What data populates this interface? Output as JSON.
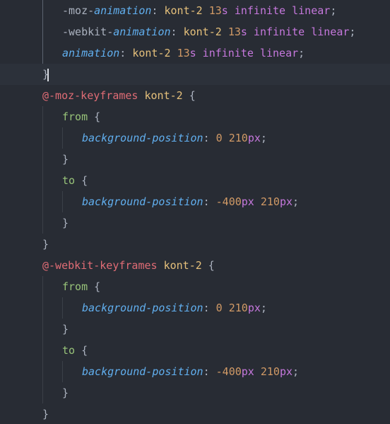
{
  "editor": {
    "theme_colors": {
      "background": "#282c34",
      "property": "#61afef",
      "name": "#e5c07b",
      "number": "#d19a66",
      "unit_keyword": "#c678dd",
      "atrule": "#e06c75",
      "selector": "#98c379",
      "punctuation": "#abb2bf"
    },
    "lines": [
      {
        "tokens": [
          {
            "text": "-moz-",
            "type": "prefix"
          },
          {
            "text": "animation",
            "type": "prop"
          },
          {
            "text": ": ",
            "type": "punct"
          },
          {
            "text": "kont-2",
            "type": "value"
          },
          {
            "text": " ",
            "type": "punct"
          },
          {
            "text": "13",
            "type": "number"
          },
          {
            "text": "s",
            "type": "unit"
          },
          {
            "text": " infinite linear",
            "type": "keyword"
          },
          {
            "text": ";",
            "type": "punct"
          }
        ]
      },
      {
        "tokens": [
          {
            "text": "-webkit-",
            "type": "prefix"
          },
          {
            "text": "animation",
            "type": "prop"
          },
          {
            "text": ": ",
            "type": "punct"
          },
          {
            "text": "kont-2",
            "type": "value"
          },
          {
            "text": " ",
            "type": "punct"
          },
          {
            "text": "13",
            "type": "number"
          },
          {
            "text": "s",
            "type": "unit"
          },
          {
            "text": " infinite linear",
            "type": "keyword"
          },
          {
            "text": ";",
            "type": "punct"
          }
        ]
      },
      {
        "tokens": [
          {
            "text": "animation",
            "type": "prop"
          },
          {
            "text": ": ",
            "type": "punct"
          },
          {
            "text": "kont-2",
            "type": "value"
          },
          {
            "text": " ",
            "type": "punct"
          },
          {
            "text": "13",
            "type": "number"
          },
          {
            "text": "s",
            "type": "unit"
          },
          {
            "text": " infinite linear",
            "type": "keyword"
          },
          {
            "text": ";",
            "type": "punct"
          }
        ]
      },
      {
        "tokens": [
          {
            "text": "}",
            "type": "punct"
          }
        ]
      },
      {
        "tokens": [
          {
            "text": "@-moz-keyframes",
            "type": "atrule"
          },
          {
            "text": " ",
            "type": "punct"
          },
          {
            "text": "kont-2",
            "type": "name"
          },
          {
            "text": " {",
            "type": "punct"
          }
        ]
      },
      {
        "tokens": [
          {
            "text": "from",
            "type": "selector"
          },
          {
            "text": " {",
            "type": "punct"
          }
        ]
      },
      {
        "tokens": [
          {
            "text": "background-position",
            "type": "prop"
          },
          {
            "text": ": ",
            "type": "punct"
          },
          {
            "text": "0",
            "type": "number"
          },
          {
            "text": " ",
            "type": "punct"
          },
          {
            "text": "210",
            "type": "number"
          },
          {
            "text": "px",
            "type": "unit"
          },
          {
            "text": ";",
            "type": "punct"
          }
        ]
      },
      {
        "tokens": [
          {
            "text": "}",
            "type": "punct"
          }
        ]
      },
      {
        "tokens": [
          {
            "text": "to",
            "type": "selector"
          },
          {
            "text": " {",
            "type": "punct"
          }
        ]
      },
      {
        "tokens": [
          {
            "text": "background-position",
            "type": "prop"
          },
          {
            "text": ": ",
            "type": "punct"
          },
          {
            "text": "-400",
            "type": "number"
          },
          {
            "text": "px",
            "type": "unit"
          },
          {
            "text": " ",
            "type": "punct"
          },
          {
            "text": "210",
            "type": "number"
          },
          {
            "text": "px",
            "type": "unit"
          },
          {
            "text": ";",
            "type": "punct"
          }
        ]
      },
      {
        "tokens": [
          {
            "text": "}",
            "type": "punct"
          }
        ]
      },
      {
        "tokens": [
          {
            "text": "}",
            "type": "punct"
          }
        ]
      },
      {
        "tokens": [
          {
            "text": "@-webkit-keyframes",
            "type": "atrule"
          },
          {
            "text": " ",
            "type": "punct"
          },
          {
            "text": "kont-2",
            "type": "name"
          },
          {
            "text": " {",
            "type": "punct"
          }
        ]
      },
      {
        "tokens": [
          {
            "text": "from",
            "type": "selector"
          },
          {
            "text": " {",
            "type": "punct"
          }
        ]
      },
      {
        "tokens": [
          {
            "text": "background-position",
            "type": "prop"
          },
          {
            "text": ": ",
            "type": "punct"
          },
          {
            "text": "0",
            "type": "number"
          },
          {
            "text": " ",
            "type": "punct"
          },
          {
            "text": "210",
            "type": "number"
          },
          {
            "text": "px",
            "type": "unit"
          },
          {
            "text": ";",
            "type": "punct"
          }
        ]
      },
      {
        "tokens": [
          {
            "text": "}",
            "type": "punct"
          }
        ]
      },
      {
        "tokens": [
          {
            "text": "to",
            "type": "selector"
          },
          {
            "text": " {",
            "type": "punct"
          }
        ]
      },
      {
        "tokens": [
          {
            "text": "background-position",
            "type": "prop"
          },
          {
            "text": ": ",
            "type": "punct"
          },
          {
            "text": "-400",
            "type": "number"
          },
          {
            "text": "px",
            "type": "unit"
          },
          {
            "text": " ",
            "type": "punct"
          },
          {
            "text": "210",
            "type": "number"
          },
          {
            "text": "px",
            "type": "unit"
          },
          {
            "text": ";",
            "type": "punct"
          }
        ]
      },
      {
        "tokens": [
          {
            "text": "}",
            "type": "punct"
          }
        ]
      },
      {
        "tokens": [
          {
            "text": "}",
            "type": "punct"
          }
        ]
      }
    ]
  }
}
